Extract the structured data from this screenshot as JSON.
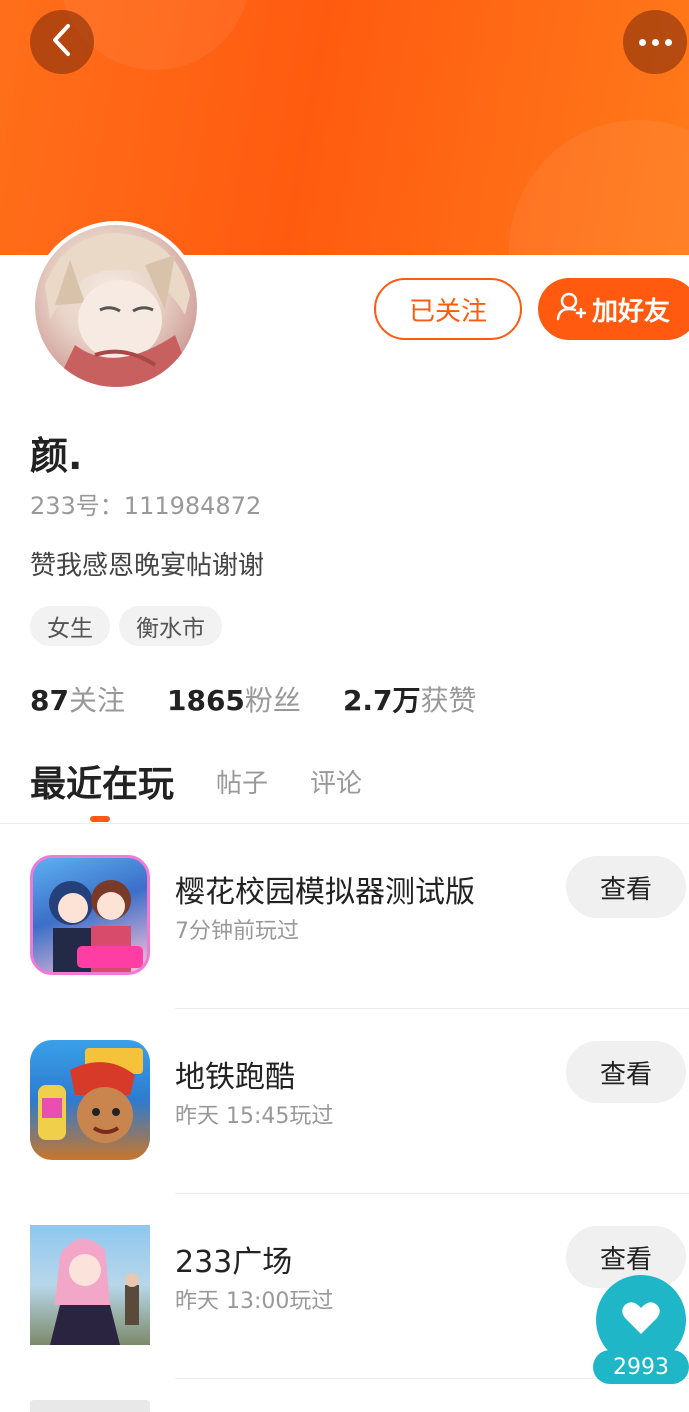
{
  "header": {
    "back_icon": "chevron-left-icon",
    "more_icon": "more-horizontal-icon",
    "colors": {
      "accent": "#ff5a10",
      "header_gradient_start": "#ff6f1a",
      "header_gradient_end": "#ff7a1a"
    }
  },
  "profile": {
    "name": "颜.",
    "id_text": "233号：111984872",
    "bio": "赞我感恩晚宴帖谢谢",
    "tags": [
      "女生",
      "衡水市"
    ],
    "follow_label": "已关注",
    "add_friend_label": "加好友"
  },
  "stats": {
    "following": {
      "num": "87",
      "label": "关注"
    },
    "fans": {
      "num": "1865",
      "label": "粉丝"
    },
    "likes": {
      "num": "2.7万",
      "label": "获赞"
    }
  },
  "tabs": [
    {
      "label": "最近在玩",
      "active": true
    },
    {
      "label": "帖子",
      "active": false
    },
    {
      "label": "评论",
      "active": false
    }
  ],
  "games": [
    {
      "title": "樱花校园模拟器测试版",
      "time": "7分钟前玩过",
      "button": "查看"
    },
    {
      "title": "地铁跑酷",
      "time": "昨天 15:45玩过",
      "button": "查看"
    },
    {
      "title": "233广场",
      "time": "昨天 13:00玩过",
      "button": "查看"
    }
  ],
  "like_fab": {
    "icon": "heart-icon",
    "count": "2993",
    "color": "#1fb6c8"
  }
}
